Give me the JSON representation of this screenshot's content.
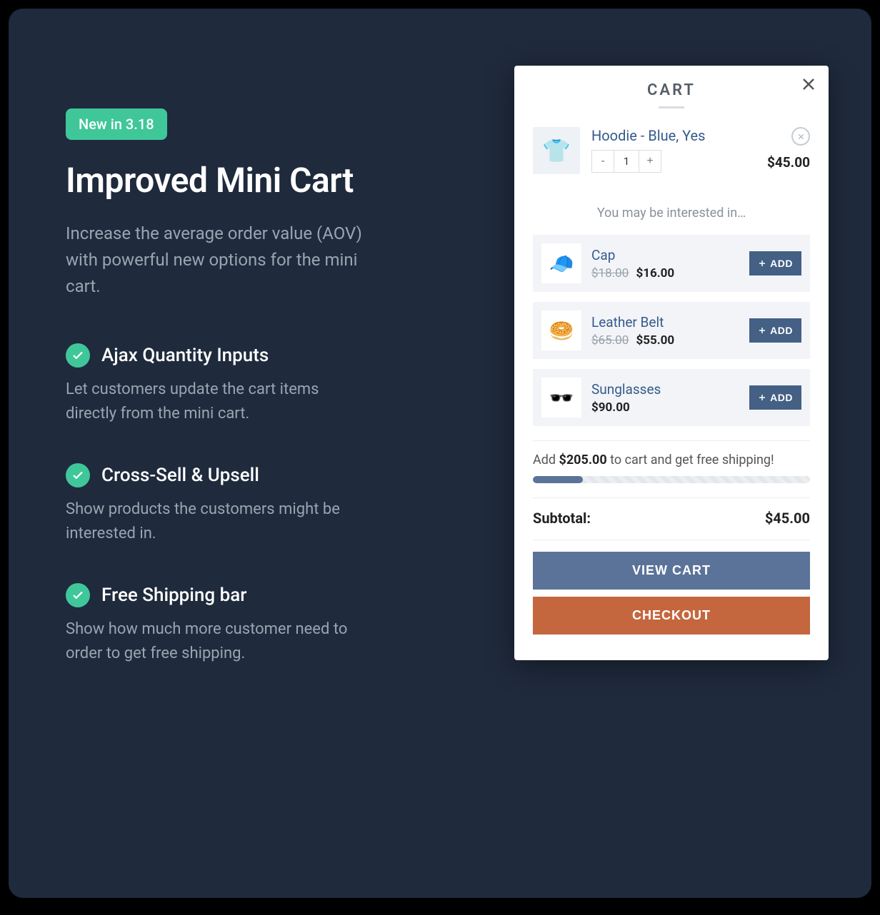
{
  "left": {
    "badge": "New in 3.18",
    "headline": "Improved Mini Cart",
    "subhead": "Increase the average order value (AOV) with powerful new options for the mini cart.",
    "features": [
      {
        "title": "Ajax Quantity Inputs",
        "desc": "Let customers update the cart items directly from the mini cart."
      },
      {
        "title": "Cross-Sell & Upsell",
        "desc": "Show products the customers might be interested in."
      },
      {
        "title": "Free Shipping bar",
        "desc": "Show how much more customer need to order to get free shipping."
      }
    ]
  },
  "cart": {
    "title": "CART",
    "item": {
      "name": "Hoodie - Blue, Yes",
      "qty": "1",
      "price": "$45.00",
      "emoji": "👕"
    },
    "interest_heading": "You may be interested in…",
    "suggestions": [
      {
        "name": "Cap",
        "old": "$18.00",
        "new": "$16.00",
        "emoji": "🧢"
      },
      {
        "name": "Leather Belt",
        "old": "$65.00",
        "new": "$55.00",
        "emoji": "🥯"
      },
      {
        "name": "Sunglasses",
        "old": "",
        "new": "$90.00",
        "emoji": "🕶️"
      }
    ],
    "add_label": "ADD",
    "free_ship": {
      "prefix": "Add ",
      "amount": "$205.00",
      "suffix": " to cart and get free shipping!",
      "progress_pct": 18
    },
    "subtotal_label": "Subtotal:",
    "subtotal_value": "$45.00",
    "view_cart": "VIEW CART",
    "checkout": "CHECKOUT"
  }
}
